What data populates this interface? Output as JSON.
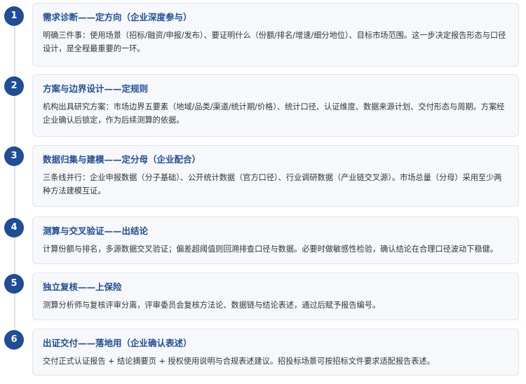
{
  "steps": [
    {
      "num": "1",
      "title": "需求诊断——定方向（企业深度参与）",
      "desc": "明确三件事：使用场景（招标/融资/申报/发布）、要证明什么（份额/排名/增速/细分地位）、目标市场范围。这一步决定报告形态与口径设计，是全程最重要的一环。"
    },
    {
      "num": "2",
      "title": "方案与边界设计——定规则",
      "desc": "机构出具研究方案：市场边界五要素（地域/品类/渠道/统计期/价格）、统计口径、认证维度、数据来源计划、交付形态与周期。方案经企业确认后锁定，作为后续测算的依据。"
    },
    {
      "num": "3",
      "title": "数据归集与建模——定分母（企业配合）",
      "desc": "三条线并行：企业申报数据（分子基础）、公开统计数据（官方口径）、行业调研数据（产业链交叉源）。市场总量（分母）采用至少两种方法建模互证。"
    },
    {
      "num": "4",
      "title": "测算与交叉验证——出结论",
      "desc": "计算份额与排名，多源数据交叉验证；偏差超阈值则回溯排查口径与数据。必要时做敏感性检验，确认结论在合理口径波动下稳健。"
    },
    {
      "num": "5",
      "title": "独立复核——上保险",
      "desc": "测算分析师与复核评审分离，评审委员会复核方法论、数据链与结论表述，通过后赋予报告编号。"
    },
    {
      "num": "6",
      "title": "出证交付——落地用（企业确认表述）",
      "desc": "交付正式认证报告 + 结论摘要页 + 授权使用说明与合规表述建议。招投标场景可按招标文件要求适配报告表述。"
    }
  ]
}
